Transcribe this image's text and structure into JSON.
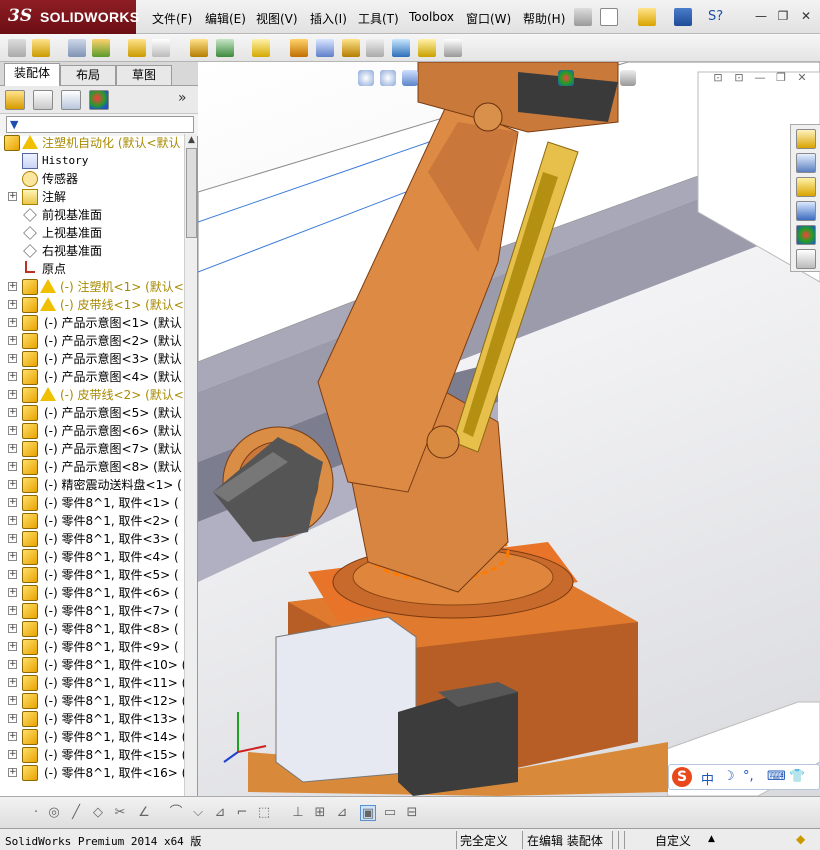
{
  "app": {
    "logo_ds": "3S",
    "logo_name": "SOLIDWORKS"
  },
  "menu": {
    "items": [
      "文件(F)",
      "编辑(E)",
      "视图(V)",
      "插入(I)",
      "工具(T)",
      "Toolbox",
      "窗口(W)",
      "帮助(H)"
    ],
    "search_label": "S?"
  },
  "panel": {
    "tabs": [
      "装配体",
      "布局",
      "草图"
    ],
    "active_tab": "装配体",
    "expand_label": "»"
  },
  "tree": {
    "rows": [
      {
        "text": "注塑机自动化  (默认<默认",
        "icon": "assembly-warn",
        "style": "yellow",
        "expand": "",
        "indent": 0
      },
      {
        "text": "History",
        "icon": "history",
        "style": "mono",
        "expand": "",
        "indent": 1
      },
      {
        "text": "传感器",
        "icon": "sensor",
        "style": "",
        "expand": "",
        "indent": 1
      },
      {
        "text": "注解",
        "icon": "annotation",
        "style": "",
        "expand": "+",
        "indent": 1
      },
      {
        "text": "前视基准面",
        "icon": "plane",
        "style": "",
        "expand": "",
        "indent": 1
      },
      {
        "text": "上视基准面",
        "icon": "plane",
        "style": "",
        "expand": "",
        "indent": 1
      },
      {
        "text": "右视基准面",
        "icon": "plane",
        "style": "",
        "expand": "",
        "indent": 1
      },
      {
        "text": "原点",
        "icon": "origin",
        "style": "",
        "expand": "",
        "indent": 1
      },
      {
        "text": "(-) 注塑机<1> (默认<",
        "icon": "part-warn",
        "style": "yellow",
        "expand": "+",
        "indent": 1
      },
      {
        "text": "(-) 皮带线<1> (默认<",
        "icon": "part-warn",
        "style": "yellow",
        "expand": "+",
        "indent": 1
      },
      {
        "text": "(-) 产品示意图<1> (默认",
        "icon": "part",
        "style": "",
        "expand": "+",
        "indent": 1
      },
      {
        "text": "(-) 产品示意图<2> (默认",
        "icon": "part",
        "style": "",
        "expand": "+",
        "indent": 1
      },
      {
        "text": "(-) 产品示意图<3> (默认",
        "icon": "part",
        "style": "",
        "expand": "+",
        "indent": 1
      },
      {
        "text": "(-) 产品示意图<4> (默认",
        "icon": "part",
        "style": "",
        "expand": "+",
        "indent": 1
      },
      {
        "text": "(-) 皮带线<2> (默认<",
        "icon": "part-warn",
        "style": "yellow",
        "expand": "+",
        "indent": 1
      },
      {
        "text": "(-) 产品示意图<5> (默认",
        "icon": "part",
        "style": "",
        "expand": "+",
        "indent": 1
      },
      {
        "text": "(-) 产品示意图<6> (默认",
        "icon": "part",
        "style": "",
        "expand": "+",
        "indent": 1
      },
      {
        "text": "(-) 产品示意图<7> (默认",
        "icon": "part",
        "style": "",
        "expand": "+",
        "indent": 1
      },
      {
        "text": "(-) 产品示意图<8> (默认",
        "icon": "part",
        "style": "",
        "expand": "+",
        "indent": 1
      },
      {
        "text": "(-) 精密震动送料盘<1> (",
        "icon": "part",
        "style": "",
        "expand": "+",
        "indent": 1
      },
      {
        "text": "(-) 零件8^1, 取件<1> (",
        "icon": "part",
        "style": "",
        "expand": "+",
        "indent": 1
      },
      {
        "text": "(-) 零件8^1, 取件<2> (",
        "icon": "part",
        "style": "",
        "expand": "+",
        "indent": 1
      },
      {
        "text": "(-) 零件8^1, 取件<3> (",
        "icon": "part",
        "style": "",
        "expand": "+",
        "indent": 1
      },
      {
        "text": "(-) 零件8^1, 取件<4> (",
        "icon": "part",
        "style": "",
        "expand": "+",
        "indent": 1
      },
      {
        "text": "(-) 零件8^1, 取件<5> (",
        "icon": "part",
        "style": "",
        "expand": "+",
        "indent": 1
      },
      {
        "text": "(-) 零件8^1, 取件<6> (",
        "icon": "part",
        "style": "",
        "expand": "+",
        "indent": 1
      },
      {
        "text": "(-) 零件8^1, 取件<7> (",
        "icon": "part",
        "style": "",
        "expand": "+",
        "indent": 1
      },
      {
        "text": "(-) 零件8^1, 取件<8> (",
        "icon": "part",
        "style": "",
        "expand": "+",
        "indent": 1
      },
      {
        "text": "(-) 零件8^1, 取件<9> (",
        "icon": "part",
        "style": "",
        "expand": "+",
        "indent": 1
      },
      {
        "text": "(-) 零件8^1, 取件<10> (",
        "icon": "part",
        "style": "",
        "expand": "+",
        "indent": 1
      },
      {
        "text": "(-) 零件8^1, 取件<11> (",
        "icon": "part",
        "style": "",
        "expand": "+",
        "indent": 1
      },
      {
        "text": "(-) 零件8^1, 取件<12> (",
        "icon": "part",
        "style": "",
        "expand": "+",
        "indent": 1
      },
      {
        "text": "(-) 零件8^1, 取件<13> (",
        "icon": "part",
        "style": "",
        "expand": "+",
        "indent": 1
      },
      {
        "text": "(-) 零件8^1, 取件<14> (",
        "icon": "part",
        "style": "",
        "expand": "+",
        "indent": 1
      },
      {
        "text": "(-) 零件8^1, 取件<15> (",
        "icon": "part",
        "style": "",
        "expand": "+",
        "indent": 1
      },
      {
        "text": "(-) 零件8^1, 取件<16> (",
        "icon": "part",
        "style": "",
        "expand": "+",
        "indent": 1
      }
    ]
  },
  "statusbar": {
    "product": "SolidWorks Premium 2014 x64 版",
    "constraint": "完全定义",
    "mode": "在编辑 装配体",
    "custom": "自定义"
  },
  "ime": {
    "logo": "S",
    "lang": "中"
  },
  "colors": {
    "robot_orange": "#d9843a",
    "robot_dark": "#b8652a",
    "base_orange": "#e07a2e",
    "brand_red": "#8e1d24"
  }
}
